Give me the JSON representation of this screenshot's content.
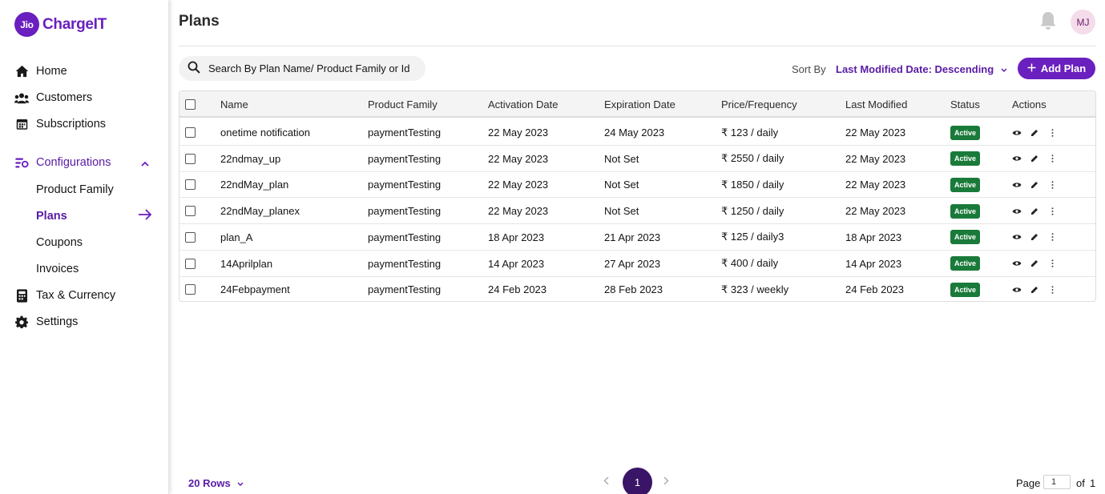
{
  "brand": {
    "badge": "Jio",
    "name": "ChargeIT"
  },
  "sidebar": {
    "items": [
      {
        "label": "Home",
        "icon": "home-icon"
      },
      {
        "label": "Customers",
        "icon": "users-icon"
      },
      {
        "label": "Subscriptions",
        "icon": "calendar-icon"
      },
      {
        "label": "Configurations",
        "icon": "configurations-icon"
      },
      {
        "label": "Tax & Currency",
        "icon": "tax-icon"
      },
      {
        "label": "Settings",
        "icon": "gear-icon"
      }
    ],
    "sub_items": [
      "Product Family",
      "Plans",
      "Coupons",
      "Invoices"
    ],
    "current": "Plans"
  },
  "header": {
    "title": "Plans",
    "avatar_initials": "MJ"
  },
  "toolbar": {
    "search_placeholder": "Search By Plan Name/ Product Family or Id",
    "sort_label": "Sort By",
    "sort_value": "Last Modified Date: Descending",
    "add_label": "Add Plan"
  },
  "table": {
    "columns": [
      "Name",
      "Product Family",
      "Activation Date",
      "Expiration Date",
      "Price/Frequency",
      "Last Modified",
      "Status",
      "Actions"
    ],
    "rows": [
      {
        "name": "onetime notification",
        "family": "paymentTesting",
        "activation": "22 May 2023",
        "expiration": "24 May 2023",
        "price": "₹ 123 / daily",
        "modified": "22 May 2023",
        "status": "Active"
      },
      {
        "name": "22ndmay_up",
        "family": "paymentTesting",
        "activation": "22 May 2023",
        "expiration": "Not Set",
        "price": "₹ 2550 / daily",
        "modified": "22 May 2023",
        "status": "Active"
      },
      {
        "name": "22ndMay_plan",
        "family": "paymentTesting",
        "activation": "22 May 2023",
        "expiration": "Not Set",
        "price": "₹ 1850 / daily",
        "modified": "22 May 2023",
        "status": "Active"
      },
      {
        "name": "22ndMay_planex",
        "family": "paymentTesting",
        "activation": "22 May 2023",
        "expiration": "Not Set",
        "price": "₹ 1250 / daily",
        "modified": "22 May 2023",
        "status": "Active"
      },
      {
        "name": "plan_A",
        "family": "paymentTesting",
        "activation": "18 Apr 2023",
        "expiration": "21 Apr 2023",
        "price": "₹ 125 / daily3",
        "modified": "18 Apr 2023",
        "status": "Active"
      },
      {
        "name": "14Aprilplan",
        "family": "paymentTesting",
        "activation": "14 Apr 2023",
        "expiration": "27 Apr 2023",
        "price": "₹ 400 / daily",
        "modified": "14 Apr 2023",
        "status": "Active"
      },
      {
        "name": "24Febpayment",
        "family": "paymentTesting",
        "activation": "24 Feb 2023",
        "expiration": "28 Feb 2023",
        "price": "₹ 323 / weekly",
        "modified": "24 Feb 2023",
        "status": "Active"
      }
    ]
  },
  "pagination": {
    "rows_label": "20 Rows",
    "current_page": "1",
    "page_label": "Page",
    "page_input": "1",
    "of_label": "of",
    "total_pages": "1"
  },
  "colors": {
    "accent": "#6a1fbf",
    "active_badge": "#1a7a3a",
    "current_page": "#3a1466"
  }
}
